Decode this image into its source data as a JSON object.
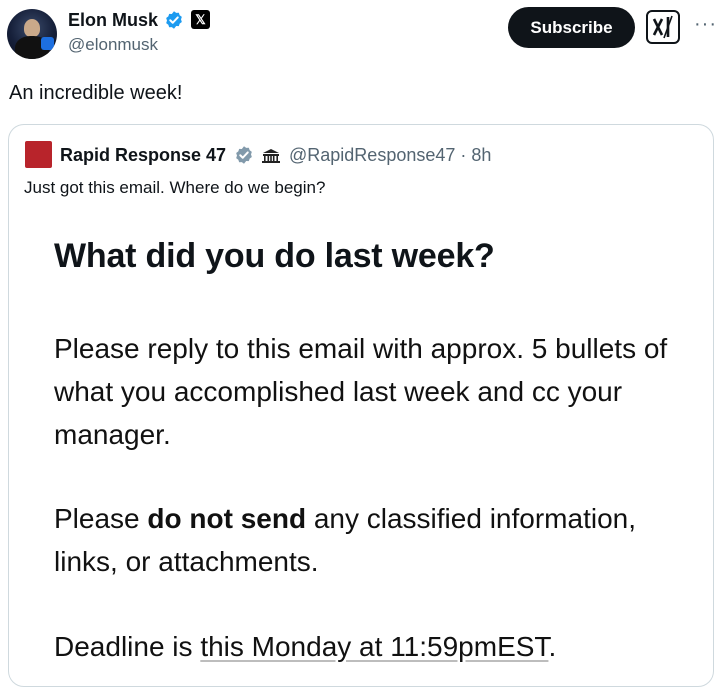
{
  "post": {
    "author_name": "Elon Musk",
    "author_handle": "@elonmusk",
    "subscribe_label": "Subscribe",
    "more_label": "···",
    "text": "An incredible week!"
  },
  "quote": {
    "author_name": "Rapid Response 47",
    "handle_time": "@RapidResponse47 · 8h",
    "text": "Just got this email. Where do we begin?",
    "email": {
      "title": "What did you do last week?",
      "para1": "Please reply to this email with approx. 5 bullets of what you accomplished last week and cc your manager.",
      "para2_pre": "Please ",
      "para2_bold": "do not send",
      "para2_post": " any classified information, links, or attachments.",
      "para3_pre": "Deadline is ",
      "para3_link": "this Monday at 11:59pmEST",
      "para3_post": "."
    }
  },
  "colors": {
    "verified": "#1d9bf0",
    "text_primary": "#0f1419",
    "text_secondary": "#536471",
    "border": "#cfd9de",
    "quote_avatar": "#b8242b"
  },
  "icons": [
    "verified-icon",
    "x-logo-icon",
    "grok-icon",
    "more-icon",
    "white-house-icon"
  ]
}
